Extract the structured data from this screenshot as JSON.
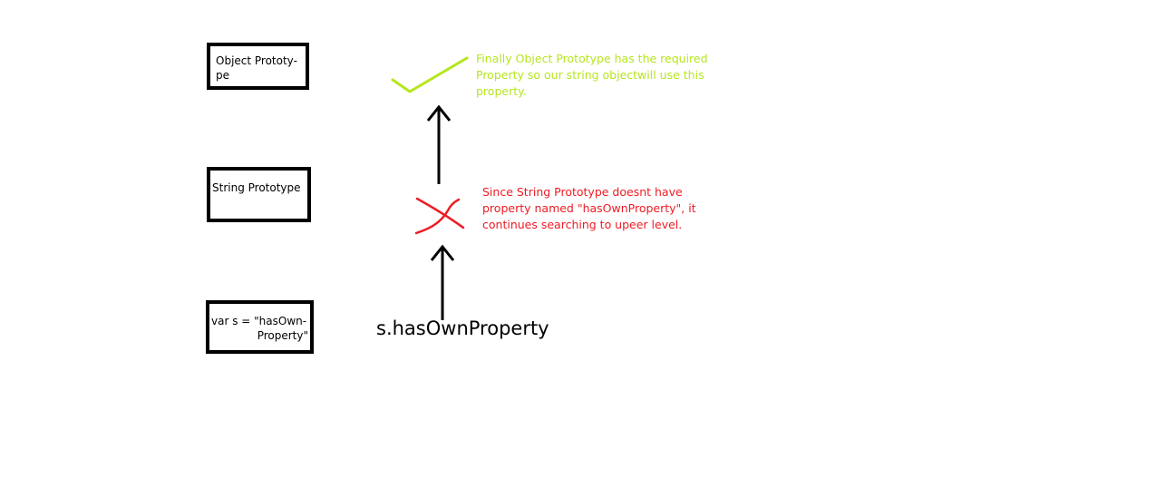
{
  "boxes": {
    "object_prototype": {
      "line1": "Object Prototy-",
      "line2": "pe"
    },
    "string_prototype": {
      "line1": "String Prototype"
    },
    "var_declaration": {
      "line1": "var s = \"hasOwn-",
      "line2": "Property\""
    }
  },
  "call_expression": "s.hasOwnProperty",
  "notes": {
    "found": {
      "lines": [
        "Finally Object Prototype has the required",
        "Property so our string objectwill use this",
        "property."
      ]
    },
    "not_found": {
      "lines": [
        "Since String Prototype doesnt have",
        "property named \"hasOwnProperty\", it",
        "continues searching to upeer level."
      ]
    }
  },
  "colors": {
    "found": "#b5e61d",
    "not_found": "#ed1c24",
    "ink": "#000000"
  },
  "icons": {
    "found": "check-icon",
    "not_found": "cross-icon"
  }
}
